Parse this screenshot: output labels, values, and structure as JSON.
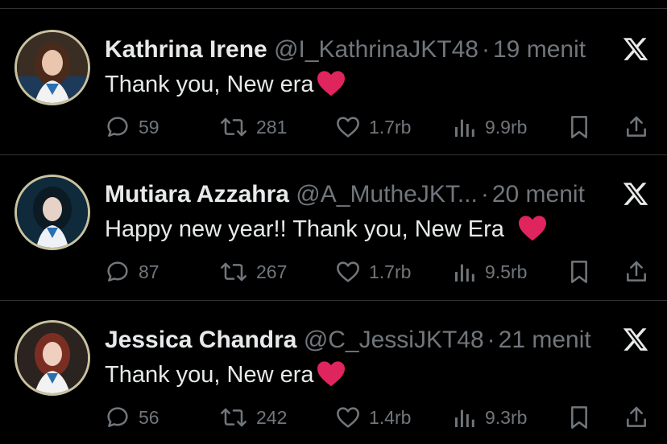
{
  "tweets": [
    {
      "name": "Kathrina Irene",
      "handle": "@I_KathrinaJKT48",
      "separator": "·",
      "time": "19 menit",
      "text": "Thank you, New era",
      "has_heart": true,
      "replies": "59",
      "reposts": "281",
      "likes": "1.7rb",
      "views": "9.9rb"
    },
    {
      "name": "Mutiara Azzahra",
      "handle": "@A_MutheJKT...",
      "separator": "·",
      "time": "20 menit",
      "text": "Happy new year!! Thank you, New Era",
      "has_heart": true,
      "replies": "87",
      "reposts": "267",
      "likes": "1.7rb",
      "views": "9.5rb"
    },
    {
      "name": "Jessica Chandra",
      "handle": "@C_JessiJKT48",
      "separator": "·",
      "time": "21 menit",
      "text": "Thank you, New era",
      "has_heart": true,
      "replies": "56",
      "reposts": "242",
      "likes": "1.4rb",
      "views": "9.3rb"
    }
  ],
  "colors": {
    "background": "#000000",
    "text_primary": "#e7e9ea",
    "text_secondary": "#71767b",
    "divider": "#2f3336",
    "heart_emoji": "#e0245e",
    "avatar_ring": "#c9c2a1"
  },
  "icons": [
    "reply-icon",
    "repost-icon",
    "like-icon",
    "views-icon",
    "bookmark-icon",
    "share-icon",
    "x-logo-icon",
    "heart-emoji"
  ]
}
